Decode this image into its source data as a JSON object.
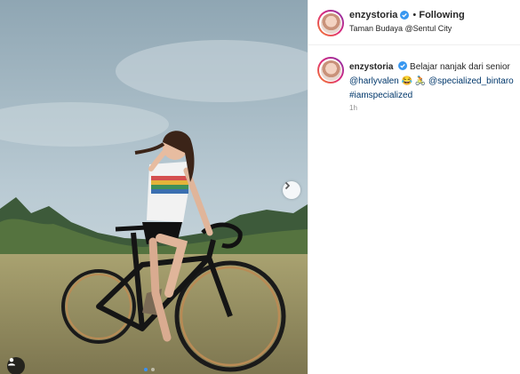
{
  "post": {
    "username": "enzystoria",
    "follow_separator": "•",
    "follow_label": "Following",
    "location": "Taman Budaya @Sentul City",
    "caption_text": "Belajar nanjak dari senior",
    "mention_1": "@harlyvalen",
    "emojis": "😂 🚴",
    "mention_2": "@specialized_bintaro",
    "hashtag": "#iamspecialized",
    "time": "1h",
    "carousel_count": 2,
    "carousel_active": 0
  }
}
